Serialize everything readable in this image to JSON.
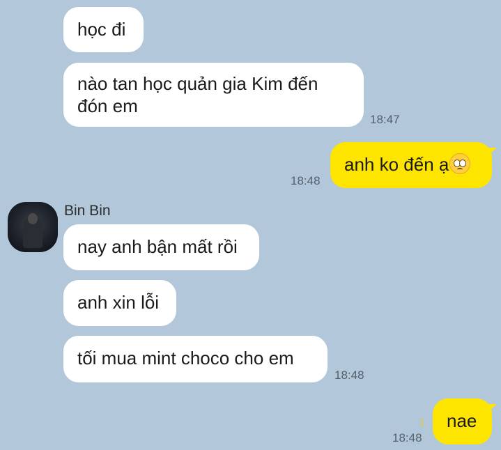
{
  "chat": {
    "messages_top": [
      {
        "text": "học đi"
      },
      {
        "text": "nào tan học quản gia Kim đến đón em",
        "time": "18:47"
      }
    ],
    "my_message_1": {
      "text": "anh ko đến ạ",
      "emoji": "pleading-face",
      "time": "18:48"
    },
    "sender": {
      "name": "Bin Bin"
    },
    "messages_bin": [
      {
        "text": "nay anh bận mất rồi"
      },
      {
        "text": "anh xin lỗi"
      },
      {
        "text": "tối mua mint choco cho em",
        "time": "18:48"
      }
    ],
    "my_message_2": {
      "text": "nae",
      "time": "18:48",
      "unread": "1"
    }
  },
  "colors": {
    "background": "#b2c7da",
    "incoming_bubble": "#ffffff",
    "outgoing_bubble": "#fee500",
    "timestamp": "#555f6a",
    "unread_count": "#e7cc1e"
  }
}
